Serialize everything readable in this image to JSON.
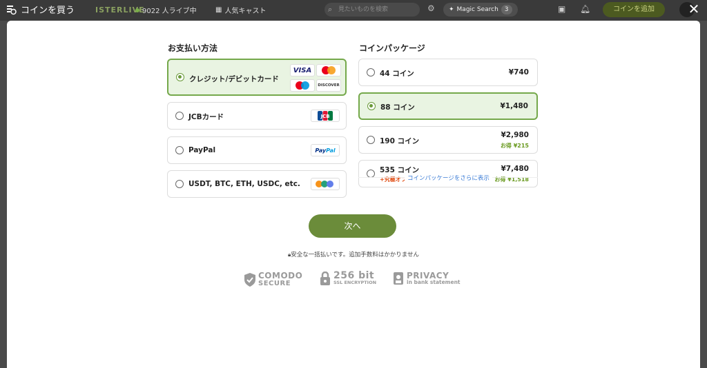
{
  "background": {
    "logo_text": "ISTERLIVE",
    "live_count": "9022 人ライブ中",
    "popular_cast": "人気キャスト",
    "search_placeholder": "見たいものを検索",
    "magic_search": "Magic Search",
    "magic_count": "3",
    "add_coin": "コインを追加"
  },
  "modal": {
    "title": "コインを買う",
    "payment_title": "お支払い方法",
    "packages_title": "コインパッケージ",
    "payment_methods": [
      {
        "label": "クレジット/デビットカード",
        "selected": true
      },
      {
        "label": "JCBカード",
        "selected": false
      },
      {
        "label": "PayPal",
        "selected": false
      },
      {
        "label": "USDT, BTC, ETH, USDC, etc.",
        "selected": false
      }
    ],
    "logos": {
      "visa": "VISA",
      "discover": "DISCOVER",
      "jcb": "JCB",
      "paypal_a": "Pay",
      "paypal_b": "Pal"
    },
    "packages": [
      {
        "name": "44 コイン",
        "price": "¥740",
        "save": "",
        "sub": "",
        "selected": false
      },
      {
        "name": "88 コイン",
        "price": "¥1,480",
        "save": "",
        "sub": "",
        "selected": true
      },
      {
        "name": "190 コイン",
        "price": "¥2,980",
        "save": "お得 ¥215",
        "sub": "",
        "selected": false
      },
      {
        "name": "535 コイン",
        "price": "¥7,480",
        "save": "お得 ¥1,518",
        "sub": "+究極オファー",
        "selected": false
      }
    ],
    "more_packages": "コインパッケージをさらに表示",
    "next_button": "次へ",
    "secure_note": "安全な一括払いです。追加手数料はかかりません",
    "badges": {
      "comodo_1": "COMODO",
      "comodo_2": "SECURE",
      "ssl_1": "256 bit",
      "ssl_2": "SSL ENCRYPTION",
      "privacy_1": "PRIVACY",
      "privacy_2": "in bank statement"
    }
  },
  "colors": {
    "accent_green": "#6b8c3a",
    "selected_bg": "#e9f4e2",
    "selected_border": "#74a84a",
    "offer_red": "#e04a10",
    "save_green": "#6a9a20",
    "link_blue": "#3a7bd5"
  }
}
